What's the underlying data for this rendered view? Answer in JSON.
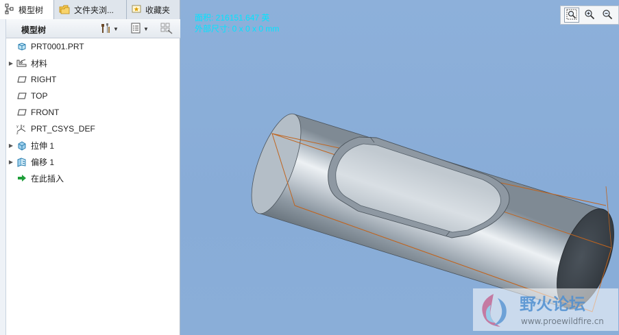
{
  "tabs": [
    {
      "label": "模型树",
      "icon": "tree-icon"
    },
    {
      "label": "文件夹浏...",
      "icon": "folder-icon"
    },
    {
      "label": "收藏夹",
      "icon": "favorites-icon"
    }
  ],
  "toolbar": {
    "title": "模型树",
    "settings_icon": "tools-icon",
    "show_icon": "list-icon",
    "filter_icon": "filter-icon"
  },
  "tree": [
    {
      "label": "PRT0001.PRT",
      "icon": "part-icon",
      "expandable": false
    },
    {
      "label": "材料",
      "icon": "material-icon",
      "expandable": true
    },
    {
      "label": "RIGHT",
      "icon": "datum-plane-icon",
      "expandable": false
    },
    {
      "label": "TOP",
      "icon": "datum-plane-icon",
      "expandable": false
    },
    {
      "label": "FRONT",
      "icon": "datum-plane-icon",
      "expandable": false
    },
    {
      "label": "PRT_CSYS_DEF",
      "icon": "csys-icon",
      "expandable": false
    },
    {
      "label": "拉伸 1",
      "icon": "extrude-icon",
      "expandable": true
    },
    {
      "label": "偏移 1",
      "icon": "offset-icon",
      "expandable": true
    },
    {
      "label": "在此插入",
      "icon": "insert-arrow-icon",
      "expandable": false
    }
  ],
  "viewport": {
    "info_line1": "面积: 216151.647 英",
    "info_line2": "外部尺寸: 0 x 0 x 0 mm",
    "zoom_buttons": [
      "zoom-fit-icon",
      "zoom-in-icon",
      "zoom-out-icon"
    ]
  },
  "watermark": {
    "text": "野火论坛",
    "url": "www.proewildfire.cn"
  },
  "colors": {
    "viewport_bg": "#8db0da",
    "info_text": "#00e5ff",
    "edge_orange": "#c0641e",
    "panel_bg": "#ffffff"
  }
}
